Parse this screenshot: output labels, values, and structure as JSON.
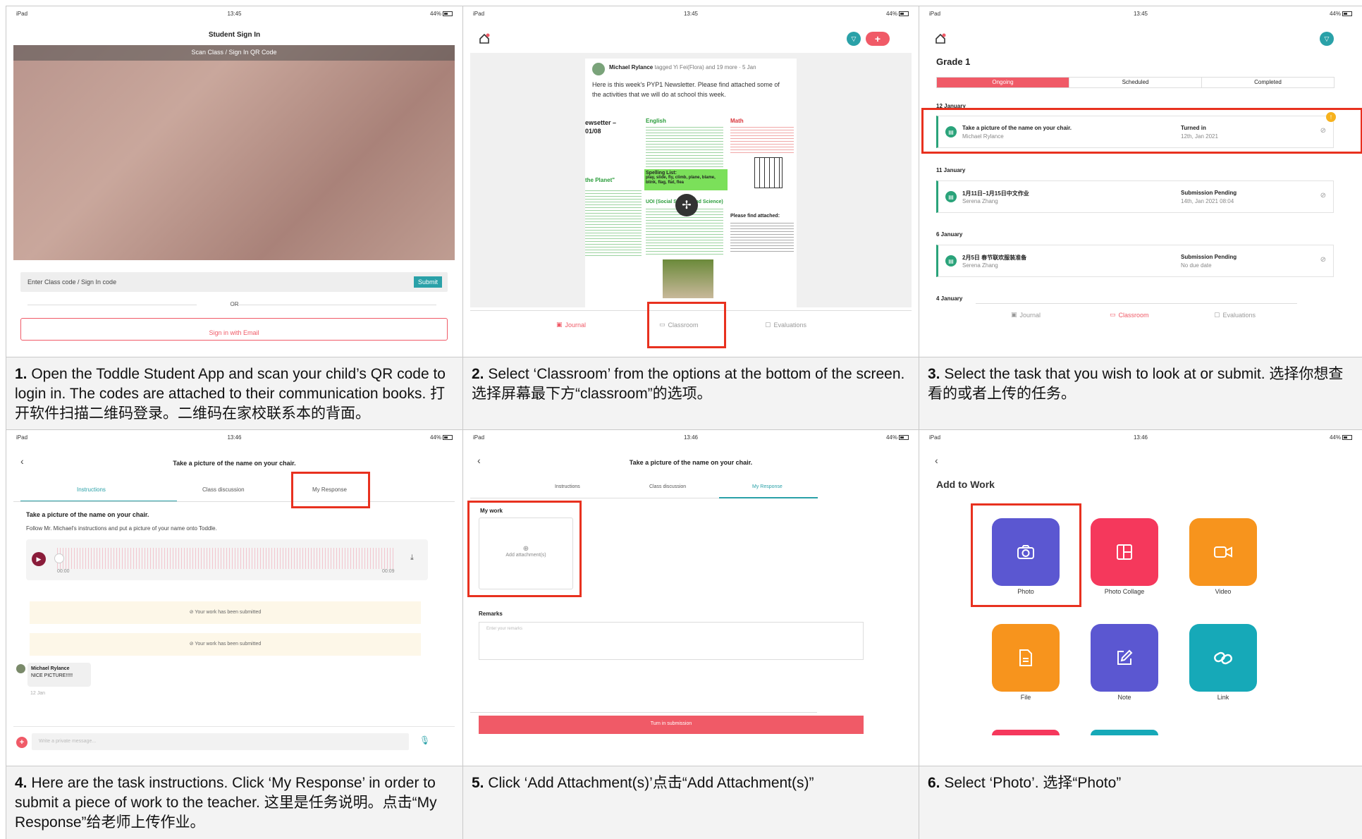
{
  "captions": [
    {
      "num": "1.",
      "text": " Open the Toddle Student App and scan your child’s QR code to login in. The codes are attached to their communication books. 打开软件扫描二维码登录。二维码在家校联系本的背面。"
    },
    {
      "num": "2.",
      "text": " Select ‘Classroom’ from the options at the bottom of the screen. 选择屏幕最下方“classroom”的选项。"
    },
    {
      "num": "3.",
      "text": " Select the task that you wish to look at or submit. 选择你想查看的或者上传的任务。"
    },
    {
      "num": "4.",
      "text": " Here are the task instructions. Click ‘My Response’ in order to submit a piece of work to the teacher. 这里是任务说明。点击“My Response”给老师上传作业。"
    },
    {
      "num": "5.",
      "text": " Click ‘Add Attachment(s)’点击“Add Attachment(s)”"
    },
    {
      "num": "6.",
      "text": " Select ‘Photo’. 选择“Photo”"
    }
  ],
  "status": {
    "carrier": "iPad",
    "battery": "44%",
    "time1": "13:45",
    "time2": "13:46"
  },
  "screen1": {
    "title": "Student Sign In",
    "scan_label": "Scan Class / Sign In QR Code",
    "code_placeholder": "Enter Class code / Sign In code",
    "submit": "Submit",
    "or": "OR",
    "email_button": "Sign in with Email"
  },
  "screen2": {
    "author": "Michael Rylance",
    "tag_text": " tagged Yi Fei(Flora) and 19 more · 5 Jan",
    "body": "Here is this week's PYP1 Newsletter. Please find attached some of the activities that we will do at school this week.",
    "nl_title": "ewsetter –",
    "nl_date": "01/08",
    "nl_english": "English",
    "nl_maths": "Math",
    "nl_spelling": "Spelling List:",
    "nl_spelling_words": "play, slide, fly, climb, plane, blame, blink, flag, flat, flea",
    "nl_planet": "the Planet\"",
    "nl_uoi": "UOI (Social Studies and Science)",
    "nl_attached": "Please find attached:",
    "tabs": {
      "journal": "Journal",
      "classroom": "Classroom",
      "evaluations": "Evaluations"
    }
  },
  "screen3": {
    "title": "Grade 1",
    "segments": [
      "Ongoing",
      "Scheduled",
      "Completed"
    ],
    "groups": [
      {
        "date": "12 January",
        "task": "Take a picture of the name on your chair.",
        "teacher": "Michael Rylance",
        "status": "Turned in",
        "due": "12th, Jan 2021"
      },
      {
        "date": "11 January",
        "task": "1月11日–1月15日中文作业",
        "teacher": "Serena Zhang",
        "status": "Submission Pending",
        "due": "14th, Jan 2021 08:04"
      },
      {
        "date": "6 January",
        "task": "2月5日 春节联欢服装准备",
        "teacher": "Serena Zhang",
        "status": "Submission Pending",
        "due": "No due date"
      },
      {
        "date": "4 January"
      }
    ],
    "tabs": {
      "journal": "Journal",
      "classroom": "Classroom",
      "evaluations": "Evaluations"
    }
  },
  "screen4": {
    "title": "Take a picture of the name on your chair.",
    "tabs": [
      "Instructions",
      "Class discussion",
      "My Response"
    ],
    "heading": "Take a picture of the name on your chair.",
    "instruction": "Follow Mr. Michael's instructions and put a picture of your name onto Toddle.",
    "audio_start": "00:00",
    "audio_end": "00:09",
    "submitted1": "Your work has been submitted",
    "submitted2": "Your work has been submitted",
    "commenter": "Michael Rylance",
    "comment": "NICE PICTURE!!!!!",
    "comment_date": "12 Jan",
    "message_placeholder": "Write a private message..."
  },
  "screen5": {
    "title": "Take a picture of the name on your chair.",
    "tabs": [
      "Instructions",
      "Class discussion",
      "My Response"
    ],
    "my_work": "My work",
    "add_attachment": "Add attachment(s)",
    "remarks": "Remarks",
    "remarks_placeholder": "Enter your remarks",
    "turn_in": "Turn in submission"
  },
  "screen6": {
    "title": "Add to Work",
    "tiles": [
      {
        "label": "Photo",
        "color": "#5b57d1",
        "icon": "camera-icon"
      },
      {
        "label": "Photo Collage",
        "color": "#f5385c",
        "icon": "collage-icon"
      },
      {
        "label": "Video",
        "color": "#f7941d",
        "icon": "video-icon"
      },
      {
        "label": "File",
        "color": "#f7941d",
        "icon": "file-icon"
      },
      {
        "label": "Note",
        "color": "#5b57d1",
        "icon": "note-icon"
      },
      {
        "label": "Link",
        "color": "#16a9b8",
        "icon": "link-icon"
      }
    ]
  }
}
